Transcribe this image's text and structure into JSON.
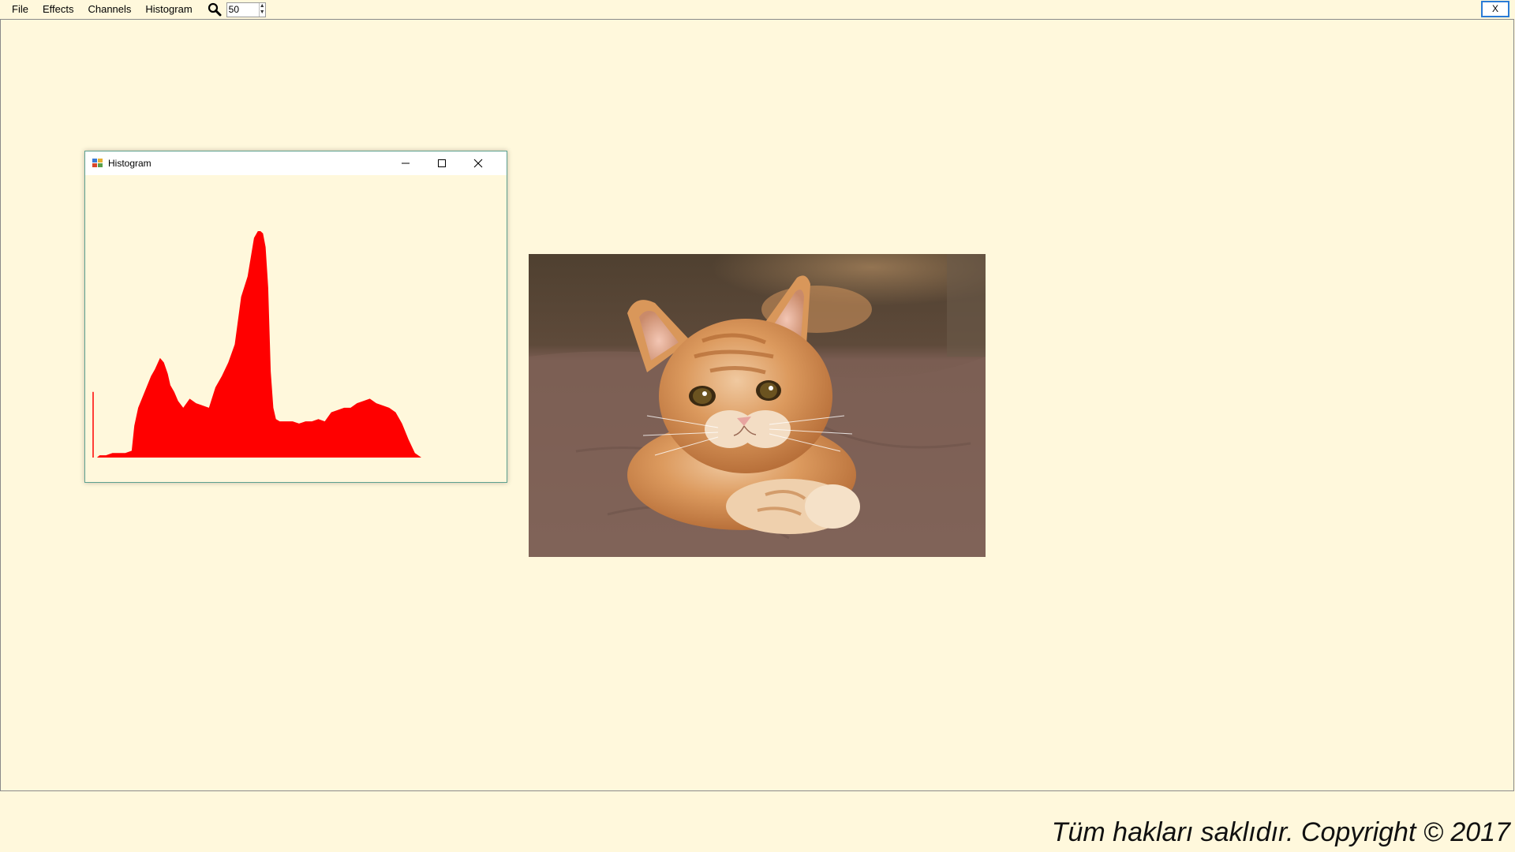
{
  "menu": {
    "items": [
      "File",
      "Effects",
      "Channels",
      "Histogram"
    ]
  },
  "toolbar": {
    "zoom_icon": "magnifier-icon",
    "zoom_value": "50"
  },
  "app_close_label": "X",
  "histogram_window": {
    "title": "Histogram",
    "icon": "app-icon",
    "controls": [
      "minimize-icon",
      "maximize-icon",
      "close-icon"
    ]
  },
  "image": {
    "subject": "orange tabby kitten lying on brown blanket"
  },
  "footer": {
    "copyright": "Tüm hakları saklıdır. Copyright © 2017"
  },
  "colors": {
    "background": "#FFF8DC",
    "histogram_fill": "#FF0000",
    "window_border": "#5da08f"
  },
  "chart_data": {
    "type": "area",
    "channel": "red",
    "xlim": [
      0,
      255
    ],
    "x": [
      0,
      3,
      5,
      10,
      15,
      20,
      25,
      30,
      32,
      35,
      40,
      45,
      48,
      52,
      55,
      58,
      60,
      63,
      66,
      70,
      75,
      80,
      85,
      90,
      95,
      100,
      105,
      110,
      115,
      120,
      125,
      128,
      130,
      132,
      134,
      136,
      138,
      140,
      142,
      145,
      150,
      155,
      160,
      165,
      170,
      175,
      180,
      185,
      190,
      195,
      200,
      205,
      210,
      215,
      220,
      225,
      230,
      235,
      240,
      245,
      250,
      255
    ],
    "values": [
      0.29,
      0,
      0.01,
      0.01,
      0.02,
      0.02,
      0.02,
      0.03,
      0.14,
      0.22,
      0.29,
      0.36,
      0.39,
      0.44,
      0.42,
      0.37,
      0.32,
      0.29,
      0.25,
      0.22,
      0.26,
      0.24,
      0.23,
      0.22,
      0.31,
      0.36,
      0.42,
      0.5,
      0.71,
      0.8,
      0.97,
      1.0,
      1.0,
      0.99,
      0.93,
      0.75,
      0.38,
      0.22,
      0.17,
      0.16,
      0.16,
      0.16,
      0.15,
      0.16,
      0.16,
      0.17,
      0.16,
      0.2,
      0.21,
      0.22,
      0.22,
      0.24,
      0.25,
      0.26,
      0.24,
      0.23,
      0.22,
      0.2,
      0.15,
      0.08,
      0.02,
      0.0
    ]
  }
}
